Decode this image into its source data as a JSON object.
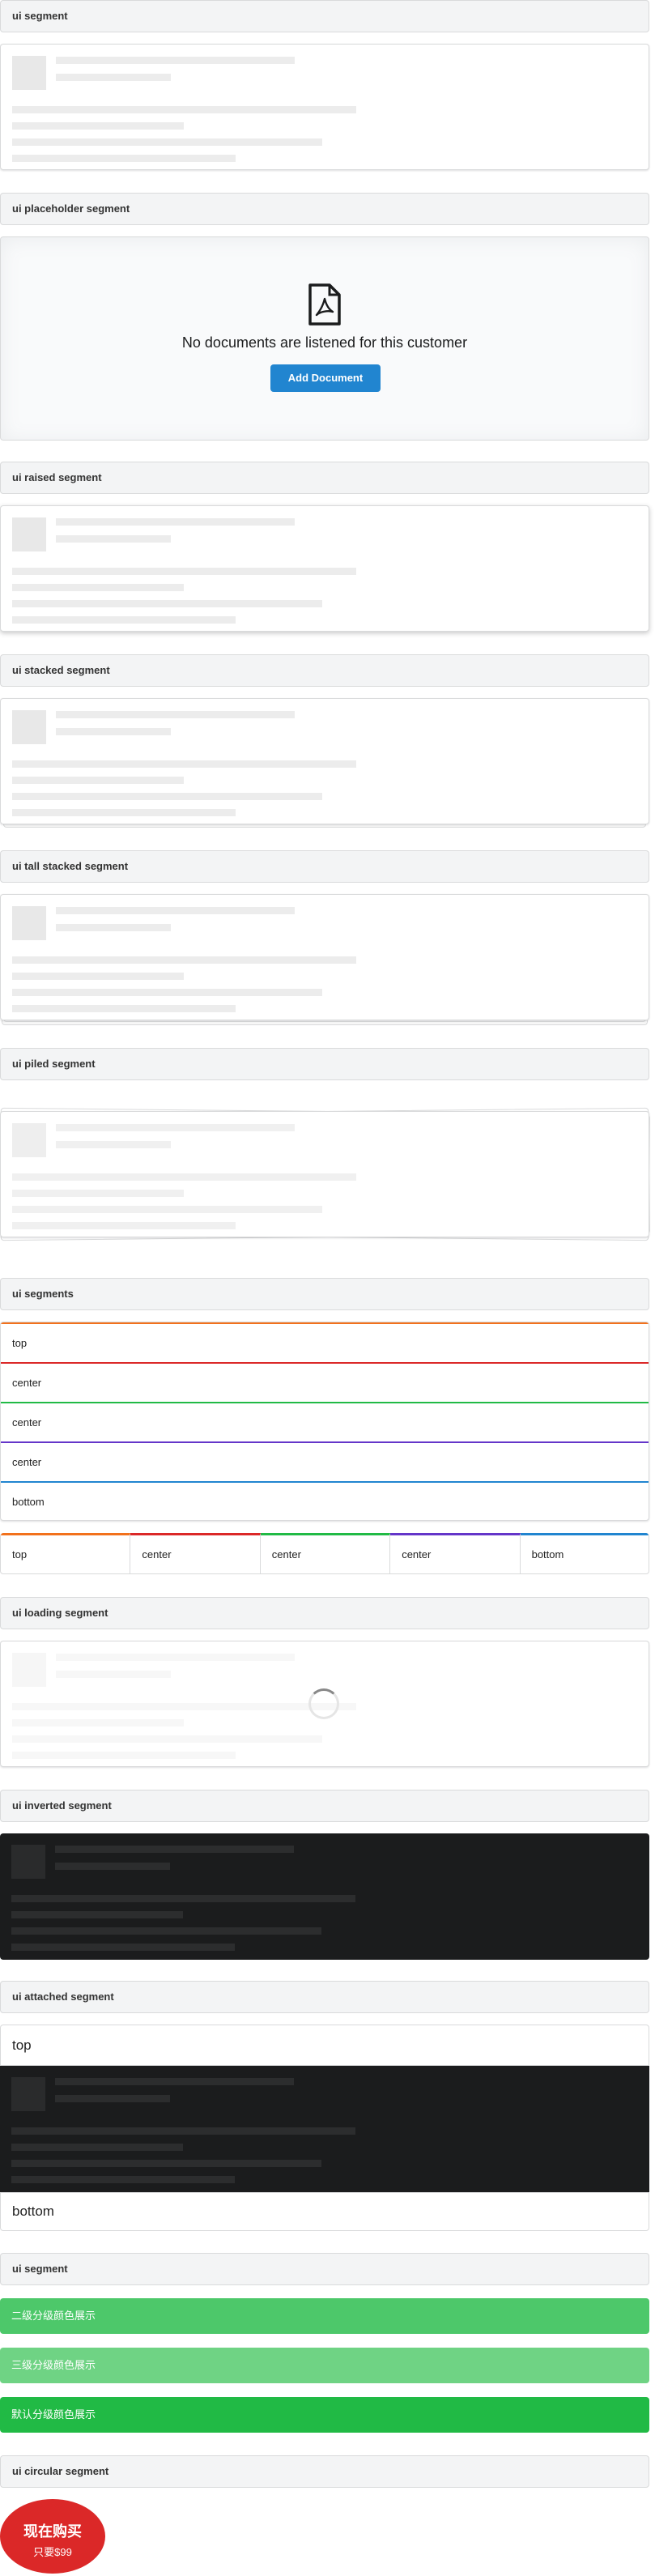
{
  "headers": {
    "segment": "ui segment",
    "placeholder": "ui placeholder segment",
    "raised": "ui raised segment",
    "stacked": "ui stacked segment",
    "tall_stacked": "ui tall stacked segment",
    "piled": "ui piled segment",
    "segments": "ui segments",
    "loading": "ui loading segment",
    "inverted": "ui inverted segment",
    "attached": "ui attached segment",
    "color_segment": "ui segment",
    "circular": "ui circular segment"
  },
  "placeholder_segment": {
    "icon": "file-pdf-icon",
    "message": "No documents are listened for this customer",
    "button_label": "Add Document"
  },
  "segments_vertical": [
    {
      "label": "top",
      "color": "#f2711c"
    },
    {
      "label": "center",
      "color": "#db2828"
    },
    {
      "label": "center",
      "color": "#21ba45"
    },
    {
      "label": "center",
      "color": "#6435c9"
    },
    {
      "label": "bottom",
      "color": "#2185d0"
    }
  ],
  "segments_horizontal": [
    {
      "label": "top",
      "color": "#f2711c"
    },
    {
      "label": "center",
      "color": "#db2828"
    },
    {
      "label": "center",
      "color": "#21ba45"
    },
    {
      "label": "center",
      "color": "#6435c9"
    },
    {
      "label": "bottom",
      "color": "#2185d0"
    }
  ],
  "attached": {
    "top": "top",
    "bottom": "bottom"
  },
  "color_bars": [
    {
      "label": "二级分级颜色展示",
      "color": "#4dc86a"
    },
    {
      "label": "三级分级颜色展示",
      "color": "#6fd384"
    },
    {
      "label": "默认分级颜色展示",
      "color": "#21ba45"
    }
  ],
  "circular": {
    "title": "现在购买",
    "subtitle": "只要$99"
  }
}
